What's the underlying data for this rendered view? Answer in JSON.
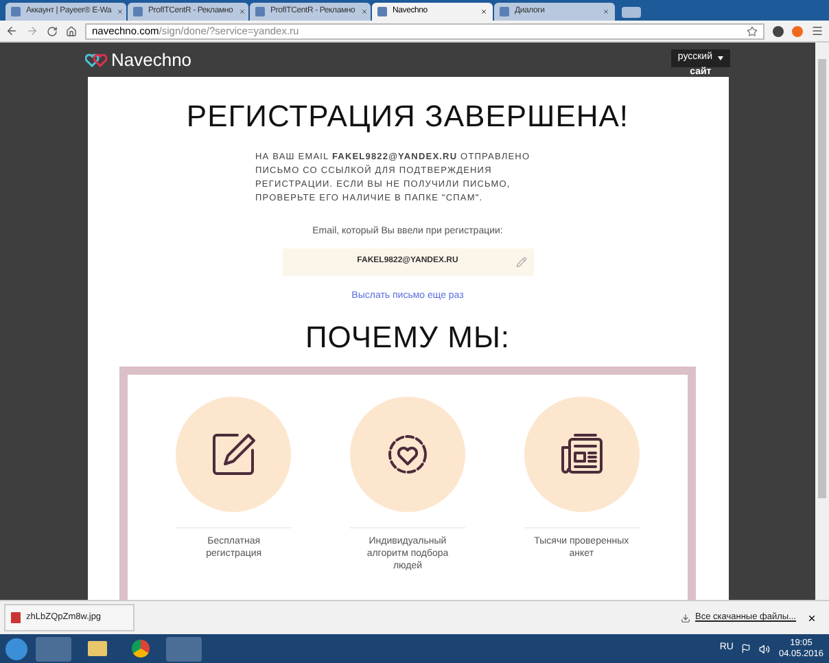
{
  "tabs": [
    {
      "title": "Аккаунт | Payeer® E-Wa",
      "selected": false
    },
    {
      "title": "ProfITCentR - Рекламно",
      "selected": false
    },
    {
      "title": "ProfITCentR - Рекламно",
      "selected": false
    },
    {
      "title": "Navechno",
      "selected": true
    },
    {
      "title": "Диалоги",
      "selected": false
    }
  ],
  "address": {
    "host": "navechno.com",
    "path": "/sign/done/?service=yandex.ru"
  },
  "site": {
    "logo": "Navechno",
    "language": "русский",
    "site_link": "сайт"
  },
  "card": {
    "title": "РЕГИСТРАЦИЯ ЗАВЕРШЕНА!",
    "message": "НА ВАШ EMAIL **FAKEL9822@YANDEX.RU** ОТПРАВЛЕНО ПИСЬМО СО ССЫЛКОЙ ДЛЯ ПОДТВЕРЖДЕНИЯ РЕГИСТРАЦИИ. ЕСЛИ ВЫ НЕ ПОЛУЧИЛИ ПИСЬМО, ПРОВЕРЬТЕ ЕГО НАЛИЧИЕ В ПАПКЕ \"СПАМ\".",
    "email_label": "Email, который Вы ввели при регистрации:",
    "email_value": "FAKEL9822@YANDEX.RU",
    "resend_link": "Выслать письмо еще раз",
    "why_title": "ПОЧЕМУ МЫ:",
    "features": [
      {
        "kind": "edit",
        "text": "Бесплатная регистрация"
      },
      {
        "kind": "gear",
        "text": "Индивидуальный алгоритм подбора людей"
      },
      {
        "kind": "news",
        "text": "Тысячи проверенных анкет"
      }
    ]
  },
  "downloads": {
    "file": "zhLbZQpZm8w.jpg",
    "all": "Все скачанные файлы..."
  },
  "taskbar": {
    "language": "RU",
    "time": "19:05",
    "date": "04.05.2016"
  }
}
